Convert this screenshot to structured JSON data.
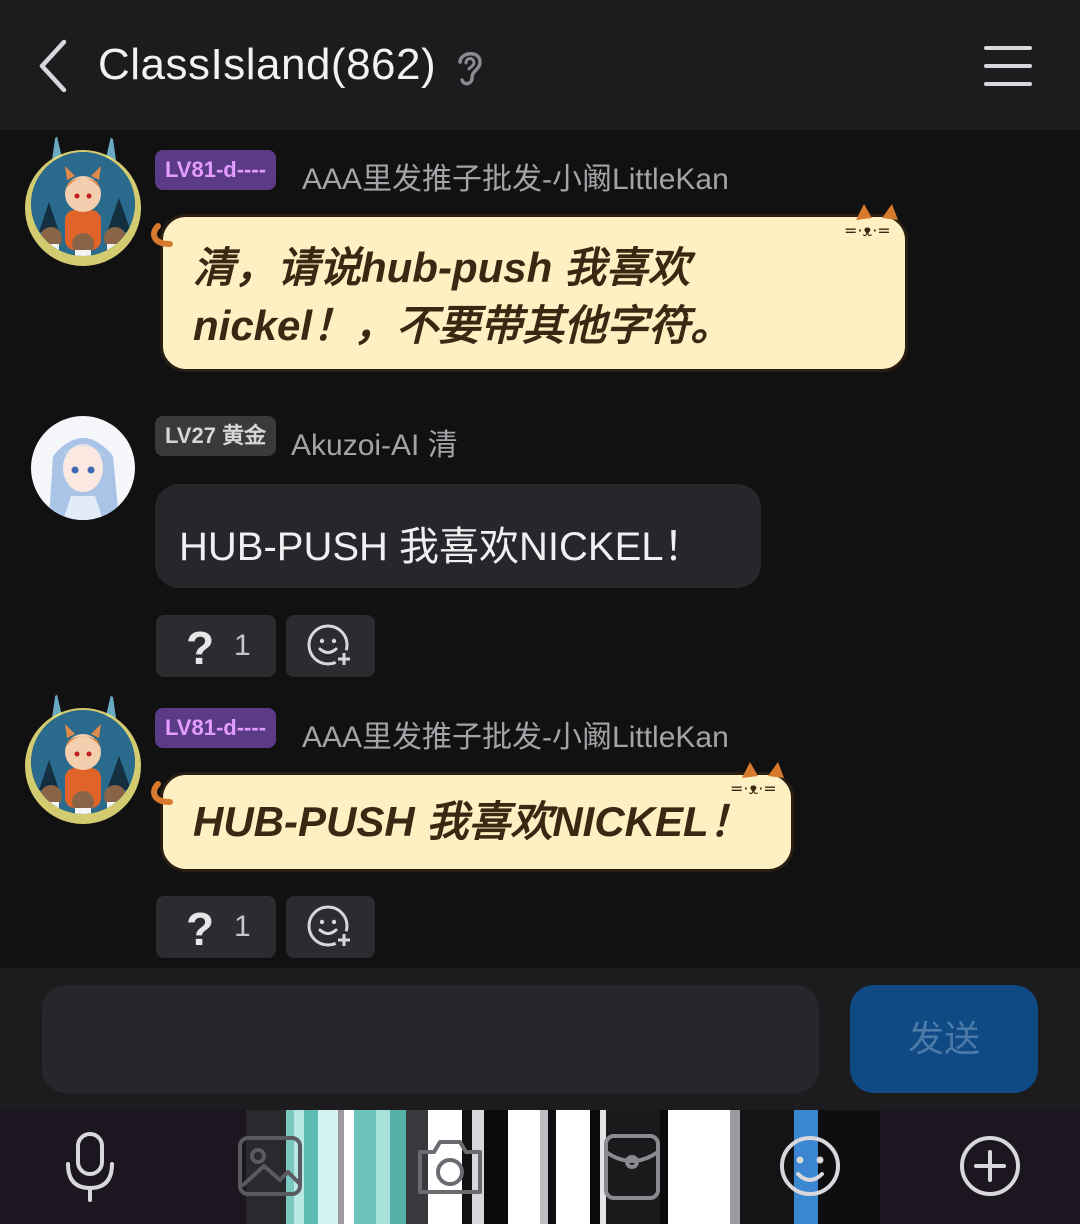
{
  "header": {
    "title": "ClassIsland(862)"
  },
  "messages": [
    {
      "level": "LV81-d----",
      "sender": "AAA里发推子批发-小阚LittleKan",
      "lines": [
        "清，请说hub-push 我喜欢",
        "nickel！，不要带其他字符。"
      ]
    },
    {
      "level": "LV27 黄金",
      "sender": "Akuzoi-AI 清",
      "text": "HUB-PUSH 我喜欢NICKEL！",
      "reaction_symbol": "?",
      "reaction_count": "1"
    },
    {
      "level": "LV81-d----",
      "sender": "AAA里发推子批发-小阚LittleKan",
      "text": "HUB-PUSH 我喜欢NICKEL！",
      "reaction_symbol": "?",
      "reaction_count": "1"
    }
  ],
  "input": {
    "placeholder": ""
  },
  "send_button": {
    "label": "发送"
  },
  "toolbar": {
    "icons": [
      "microphone-icon",
      "image-icon",
      "camera-icon",
      "red-packet-icon",
      "emoji-icon",
      "plus-icon"
    ]
  },
  "colors": {
    "background": "#111112",
    "header": "#1c1c1e",
    "bubble_cat": "#fdf1c4",
    "bubble_plain": "#26272b",
    "badge_purple_text": "#e39cff",
    "send_button": "#0f4a84"
  }
}
